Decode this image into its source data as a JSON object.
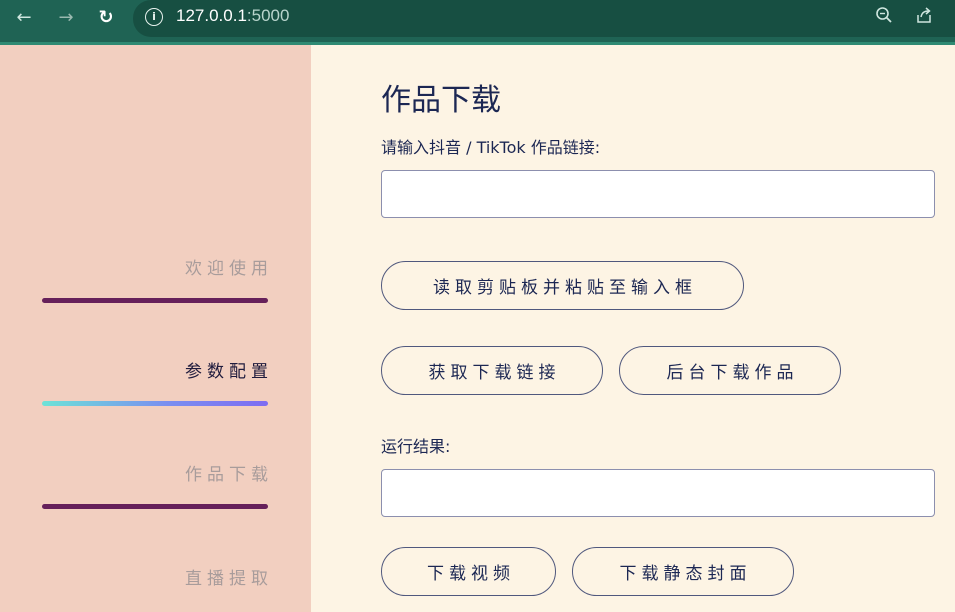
{
  "browser": {
    "url_host": "127.0.0.1",
    "url_port": ":5000"
  },
  "sidebar": {
    "items": [
      {
        "label": "欢迎使用",
        "active": false
      },
      {
        "label": "参数配置",
        "active": true
      },
      {
        "label": "作品下载",
        "active": false
      },
      {
        "label": "直播提取",
        "active": false
      }
    ]
  },
  "main": {
    "title": "作品下载",
    "link_label": "请输入抖音 / TikTok 作品链接:",
    "link_value": "",
    "paste_button": "读取剪贴板并粘贴至输入框",
    "get_link_button": "获取下载链接",
    "bg_download_button": "后台下载作品",
    "result_label": "运行结果:",
    "result_value": "",
    "download_video_button": "下载视频",
    "download_cover_button": "下载静态封面"
  },
  "colors": {
    "chrome": "#1f6354",
    "sidebar_bg": "#f2cfc0",
    "main_bg": "#fdf4e4",
    "text_primary": "#1c2753",
    "sidebar_bar": "#66205a"
  }
}
